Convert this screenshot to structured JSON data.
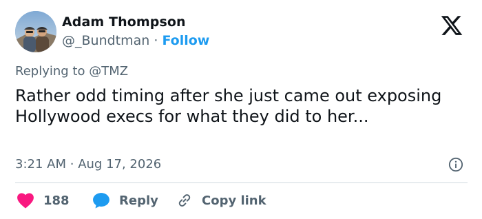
{
  "author": {
    "name": "Adam Thompson",
    "handle": "@_Bundtman",
    "separator": "·",
    "follow_label": "Follow",
    "avatar": "profile-photo"
  },
  "platform_icon": "x-logo-icon",
  "reply_context": {
    "prefix": "Replying to",
    "mention": "@TMZ"
  },
  "tweet": {
    "text": "Rather odd timing after she just came out exposing Hollywood execs for what they did to her..."
  },
  "timestamp": {
    "time": "3:21 AM",
    "separator": "·",
    "date": "Aug 17, 2026"
  },
  "actions": {
    "like_count": "188",
    "reply_label": "Reply",
    "copy_label": "Copy link"
  },
  "colors": {
    "accent": "#1d9bf0",
    "heart": "#f91880",
    "secondary_text": "#536471",
    "primary_text": "#0f1419"
  }
}
